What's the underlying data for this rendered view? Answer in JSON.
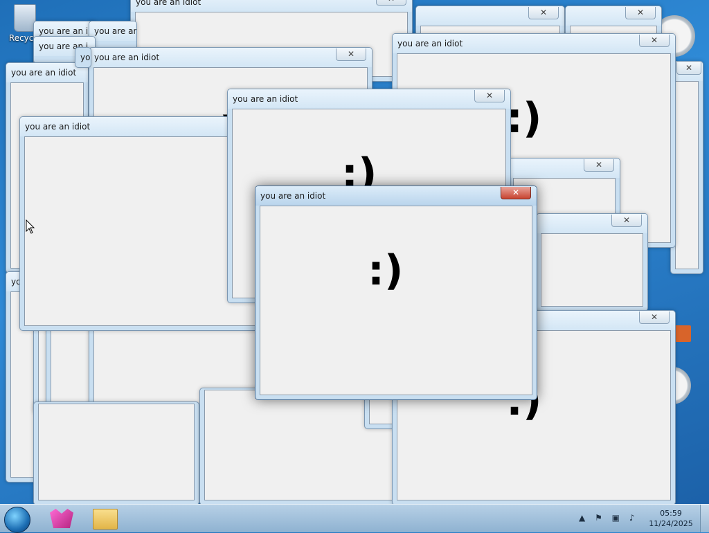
{
  "desktop": {
    "recycle_bin_label": "Recycle"
  },
  "windows": {
    "title": "you are an idiot",
    "close_glyph": "✕",
    "smiley": ":)",
    "truncated_titles": [
      "you are an i",
      "you are an id",
      "yo",
      "yo"
    ]
  },
  "taskbar": {
    "clock_time": "05:59",
    "clock_date": "11/24/2025",
    "tray_icons": [
      "show-hidden-icons-icon",
      "action-center-icon",
      "network-icon",
      "volume-icon"
    ]
  },
  "colors": {
    "titlebar": "#d3e6f5",
    "client": "#f0f0f0",
    "close_active": "#c84330"
  }
}
